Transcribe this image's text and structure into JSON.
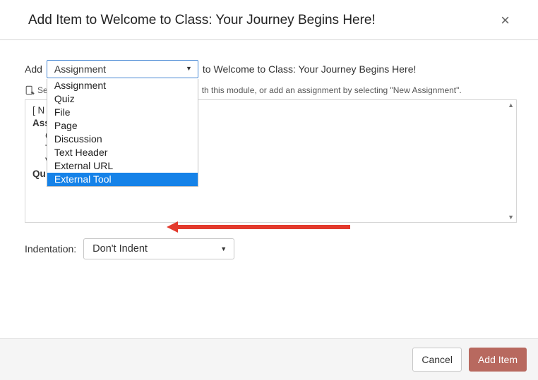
{
  "header": {
    "title": "Add Item to Welcome to Class: Your Journey Begins Here!"
  },
  "addRow": {
    "leading": "Add",
    "selected": "Assignment",
    "trailing": "to Welcome to Class: Your Journey Begins Here!"
  },
  "hint": {
    "prefix": "Se",
    "rest": "th this module, or add an assignment by selecting \"New Assignment\"."
  },
  "typeOptions": {
    "0": "Assignment",
    "1": "Quiz",
    "2": "File",
    "3": "Page",
    "4": "Discussion",
    "5": "Text Header",
    "6": "External URL",
    "7": "External Tool"
  },
  "listBox": {
    "row0": "[ N",
    "row1": "Ass",
    "row2": "C",
    "row3": "T",
    "row4": "V",
    "row5": "Qu"
  },
  "indentation": {
    "label": "Indentation:",
    "value": "Don't Indent"
  },
  "footer": {
    "cancel": "Cancel",
    "add": "Add Item"
  },
  "colors": {
    "highlight": "#1582e8",
    "arrow": "#e33a2d",
    "primary": "#b8695f"
  }
}
